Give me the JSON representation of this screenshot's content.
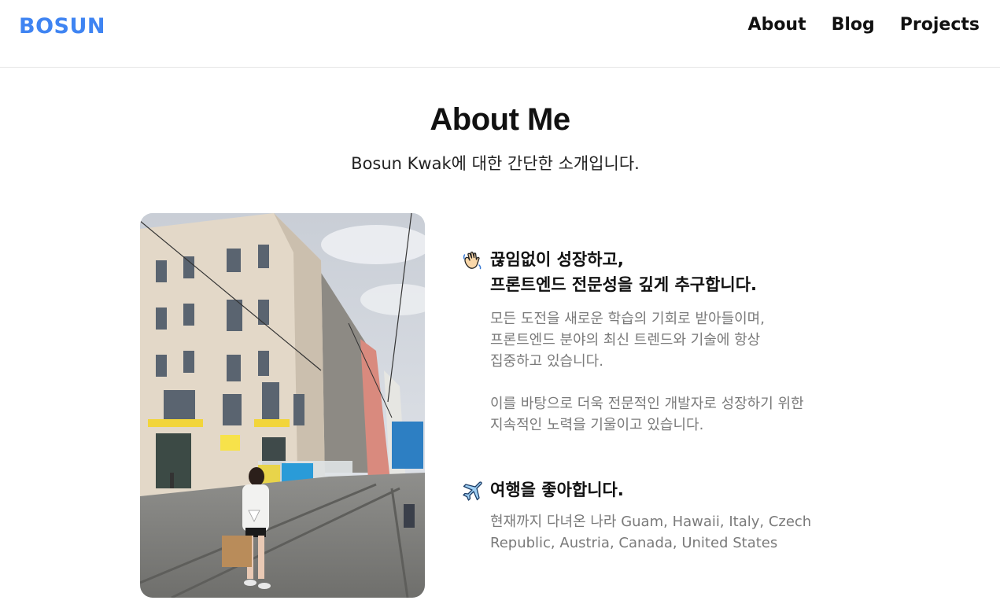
{
  "header": {
    "logo": "BOSUN",
    "nav": [
      "About",
      "Blog",
      "Projects"
    ]
  },
  "main": {
    "title": "About Me",
    "subtitle": "Bosun Kwak에 대한 간단한 소개입니다."
  },
  "sections": [
    {
      "icon": "waving-hand-icon",
      "title_lines": [
        "끊임없이 성장하고,",
        "프론트엔드 전문성을 깊게 추구합니다."
      ],
      "paragraphs": [
        [
          "모든 도전을 새로운 학습의 기회로 받아들이며,",
          "프론트엔드 분야의 최신 트렌드와 기술에 항상",
          "집중하고 있습니다."
        ],
        [
          "이를 바탕으로 더욱 전문적인 개발자로 성장하기 위한",
          "지속적인 노력을 기울이고 있습니다."
        ]
      ]
    },
    {
      "icon": "airplane-icon",
      "title_lines": [
        "여행을 좋아합니다."
      ],
      "paragraphs": [
        [
          "현재까지 다녀온 나라 Guam, Hawaii, Italy, Czech",
          "Republic, Austria, Canada, United States"
        ]
      ]
    }
  ],
  "colors": {
    "brand": "#3f84f2",
    "text": "#111111",
    "muted": "#7a7a7a",
    "divider": "#e6e6e6"
  }
}
